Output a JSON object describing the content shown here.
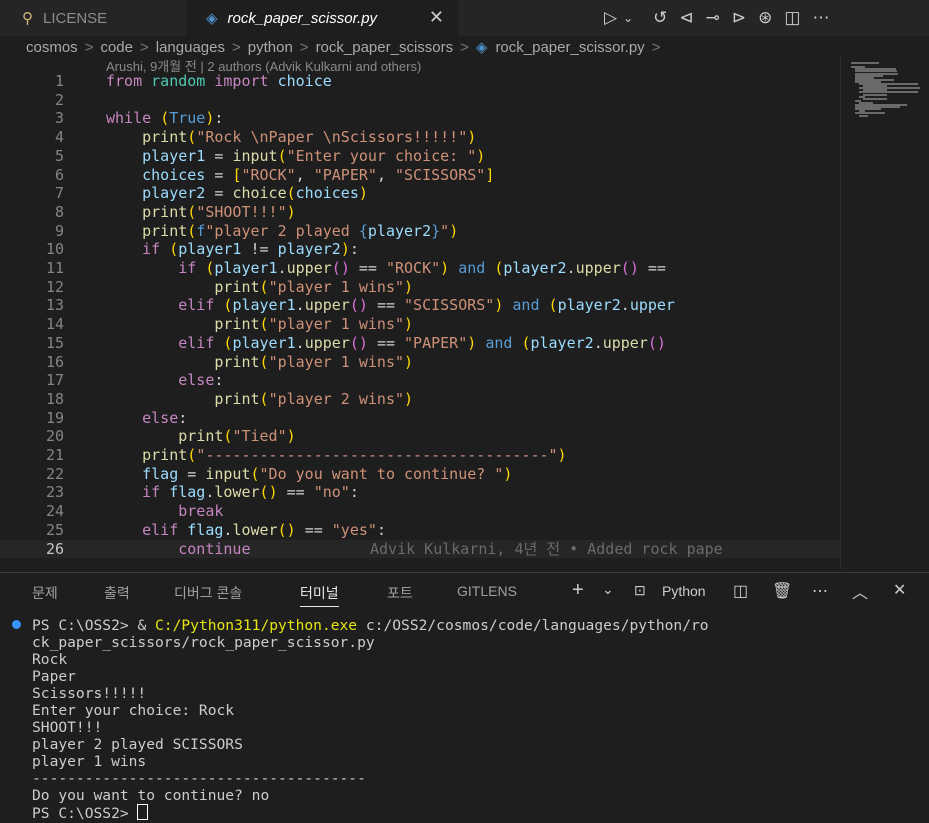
{
  "tabs": {
    "license": "LICENSE",
    "file": "rock_paper_scissor.py",
    "close": "✕"
  },
  "breadcrumb": [
    "cosmos",
    "code",
    "languages",
    "python",
    "rock_paper_scissors",
    "rock_paper_scissor.py"
  ],
  "blame_header": "Arushi, 9개월 전 | 2 authors (Advik Kulkarni and others)",
  "inline_blame": "Advik Kulkarni, 4년 전 • Added rock pape",
  "panel": {
    "tabs": [
      "문제",
      "출력",
      "디버그 콘솔",
      "터미널",
      "포트",
      "GITLENS"
    ],
    "selected_tab": "터미널",
    "shell": "Python"
  },
  "terminal": {
    "prompt1": "PS C:\\OSS2> ",
    "amp": "& ",
    "exe": "C:/Python311/python.exe",
    "arg1": " c:/OSS2/cosmos/code/languages/python/ro",
    "arg2": "ck_paper_scissors/rock_paper_scissor.py",
    "out": [
      "Rock",
      "Paper",
      "Scissors!!!!!",
      "Enter your choice: Rock",
      "SHOOT!!!",
      "player 2 played SCISSORS",
      "player 1 wins",
      "--------------------------------------",
      "Do you want to continue? no"
    ],
    "prompt2": "PS C:\\OSS2> "
  },
  "colors": {
    "accent": "#3794ff",
    "keyword": "#569cd6",
    "control": "#c586c0",
    "string": "#ce9178",
    "variable": "#9cdcfe",
    "function": "#dcdcaa"
  },
  "code_lines": [
    "from random import choice",
    "",
    "while (True):",
    "    print(\"Rock \\nPaper \\nScissors!!!!!\")",
    "    player1 = input(\"Enter your choice: \")",
    "    choices = [\"ROCK\", \"PAPER\", \"SCISSORS\"]",
    "    player2 = choice(choices)",
    "    print(\"SHOOT!!!\")",
    "    print(f\"player 2 played {player2}\")",
    "    if (player1 != player2):",
    "        if (player1.upper() == \"ROCK\") and (player2.upper() ==",
    "            print(\"player 1 wins\")",
    "        elif (player1.upper() == \"SCISSORS\") and (player2.upper",
    "            print(\"player 1 wins\")",
    "        elif (player1.upper() == \"PAPER\") and (player2.upper()",
    "            print(\"player 1 wins\")",
    "        else:",
    "            print(\"player 2 wins\")",
    "    else:",
    "        print(\"Tied\")",
    "    print(\"--------------------------------------\")",
    "    flag = input(\"Do you want to continue? \")",
    "    if flag.lower() == \"no\":",
    "        break",
    "    elif flag.lower() == \"yes\":",
    "        continue"
  ]
}
